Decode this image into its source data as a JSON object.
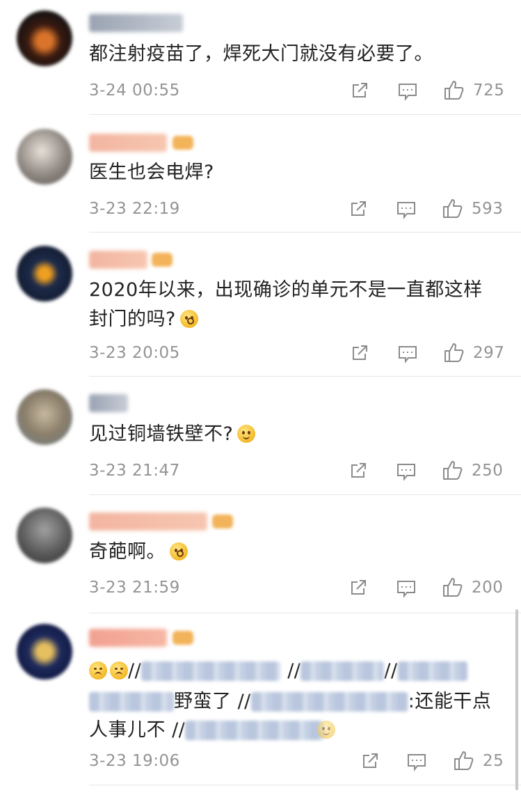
{
  "comments": [
    {
      "text": "都注射疫苗了，焊死大门就没有必要了。",
      "time": "3-24 00:55",
      "likes": "725"
    },
    {
      "text": "医生也会电焊?",
      "time": "3-23 22:19",
      "likes": "593"
    },
    {
      "text_line1": "2020年以来，出现确诊的单元不是一直都这样",
      "text_line2": "封门的吗?",
      "time": "3-23 20:05",
      "likes": "297"
    },
    {
      "text": "见过铜墙铁壁不?",
      "time": "3-23 21:47",
      "likes": "250"
    },
    {
      "text": "奇葩啊。",
      "time": "3-23 21:59",
      "likes": "200"
    },
    {
      "sep1": "//",
      "sep2": "//",
      "sep3": "//",
      "frag_a": "野蛮了 //",
      "frag_b": ":还能干点",
      "frag_c": "人事儿不 //",
      "time": "3-23 19:06",
      "likes": "25"
    }
  ],
  "icons": {
    "repost": "share-icon",
    "comment": "comment-icon",
    "like": "thumbs-up-icon"
  }
}
